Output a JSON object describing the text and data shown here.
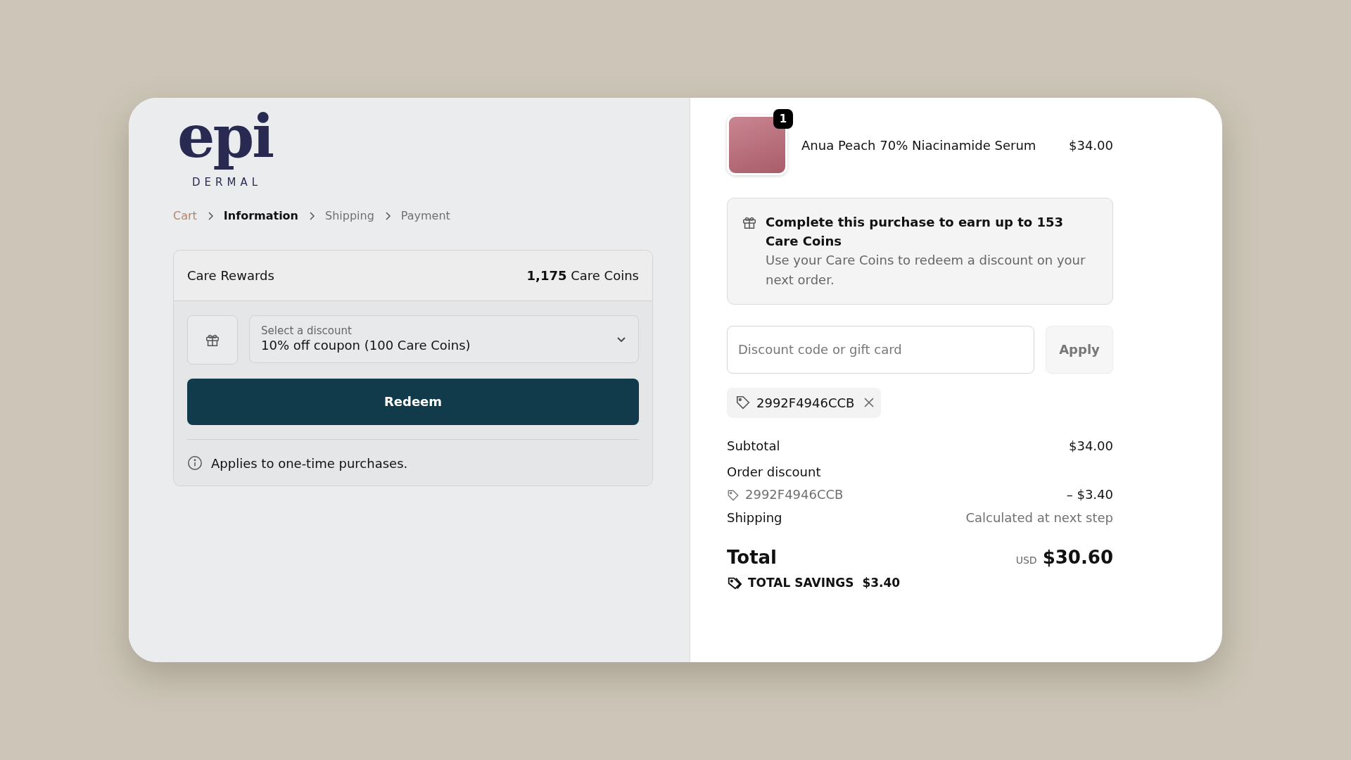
{
  "brand": {
    "wordmark": "epi",
    "subtitle": "DERMAL"
  },
  "breadcrumb": [
    {
      "label": "Cart",
      "kind": "link",
      "selected": false
    },
    {
      "label": "Information",
      "kind": "step",
      "selected": true
    },
    {
      "label": "Shipping",
      "kind": "step",
      "selected": false
    },
    {
      "label": "Payment",
      "kind": "step",
      "selected": false
    }
  ],
  "rewards": {
    "title": "Care Rewards",
    "balance_number": "1,175",
    "balance_unit": "Care Coins",
    "select": {
      "label": "Select a discount",
      "value": "10% off coupon (100 Care Coins)"
    },
    "button": "Redeem",
    "note": "Applies to one-time purchases."
  },
  "cart_items": [
    {
      "name": "Anua Peach 70% Niacinamide Serum",
      "price": "$34.00",
      "quantity": "1"
    }
  ],
  "earn_notice": {
    "title": "Complete this purchase to earn up to 153 Care Coins",
    "text": "Use your Care Coins to redeem a discount on your next order."
  },
  "discount": {
    "placeholder": "Discount code or gift card",
    "button": "Apply",
    "applied_codes": [
      "2992F4946CCB"
    ]
  },
  "summary": [
    {
      "kind": "line",
      "label": "Subtotal",
      "value": "$34.00"
    },
    {
      "kind": "discount",
      "label": "Order discount",
      "code": "2992F4946CCB",
      "value": "– $3.40"
    },
    {
      "kind": "note",
      "label": "Shipping",
      "value": "Calculated at next step"
    }
  ],
  "total": {
    "label": "Total",
    "currency": "USD",
    "value": "$30.60",
    "savings_label": "TOTAL SAVINGS",
    "savings_value": "$3.40"
  }
}
